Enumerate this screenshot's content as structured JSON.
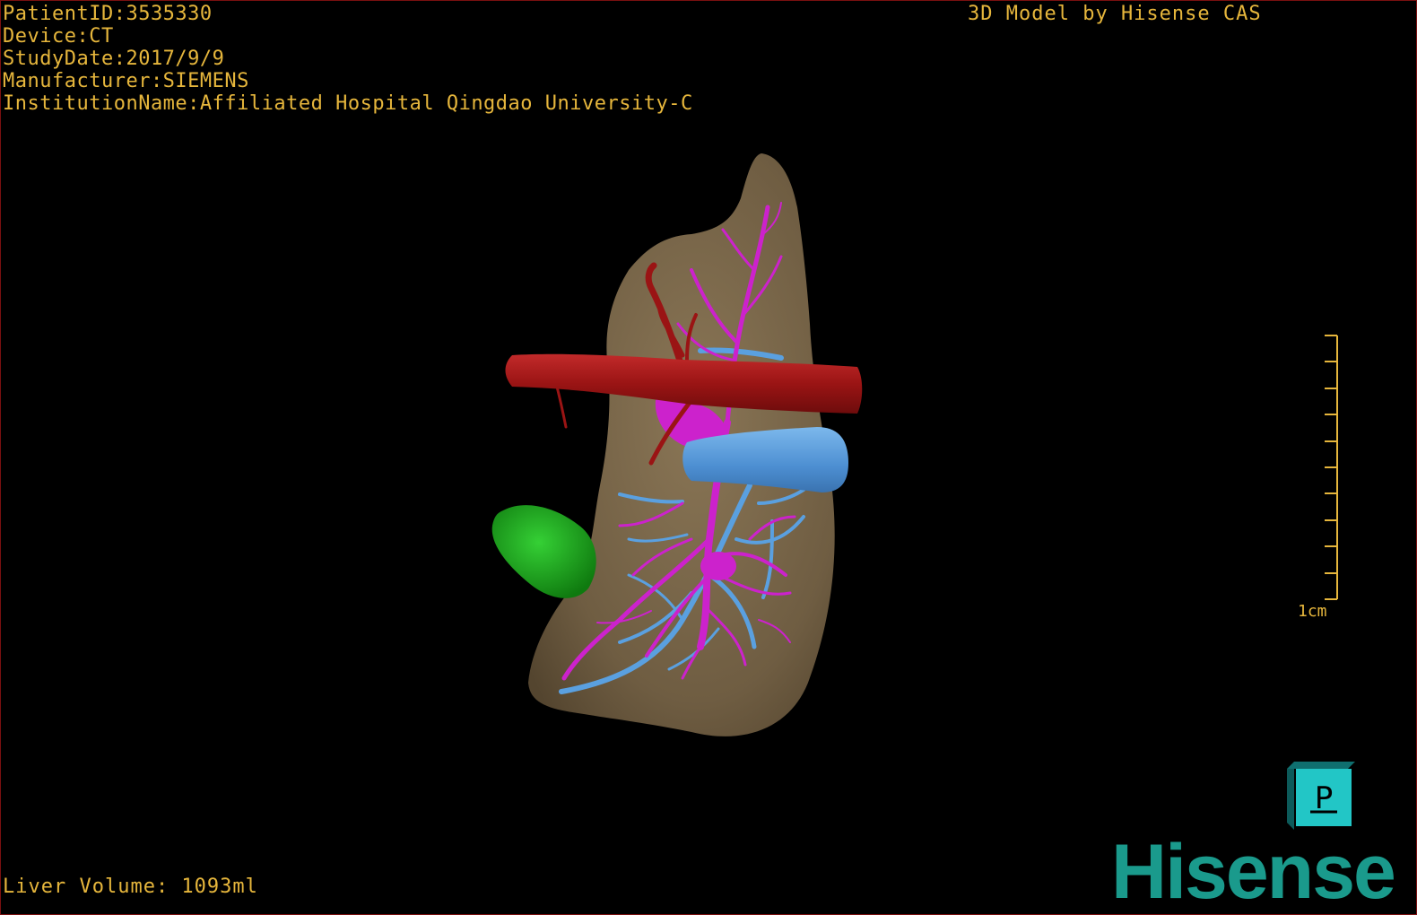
{
  "overlay": {
    "patient_id": "PatientID:3535330",
    "device": "Device:CT",
    "study_date": "StudyDate:2017/9/9",
    "manufacturer": "Manufacturer:SIEMENS",
    "institution": "InstitutionName:Affiliated Hospital Qingdao University-C",
    "credit": "3D Model by Hisense CAS",
    "liver_volume": "Liver Volume: 1093ml"
  },
  "scale_bar": {
    "label": "1cm"
  },
  "orientation_cube": {
    "face_label": "P"
  },
  "brand": {
    "logo_text": "Hisense"
  },
  "colors": {
    "text": "#e6b63c",
    "liver": "#7d6a4e",
    "artery": "#a01818",
    "portal_vein": "#cc22cc",
    "hepatic_vein": "#5aa0e0",
    "lesion": "#1fa81f",
    "cube": "#22c6c6",
    "brand": "#1a9a8c"
  }
}
